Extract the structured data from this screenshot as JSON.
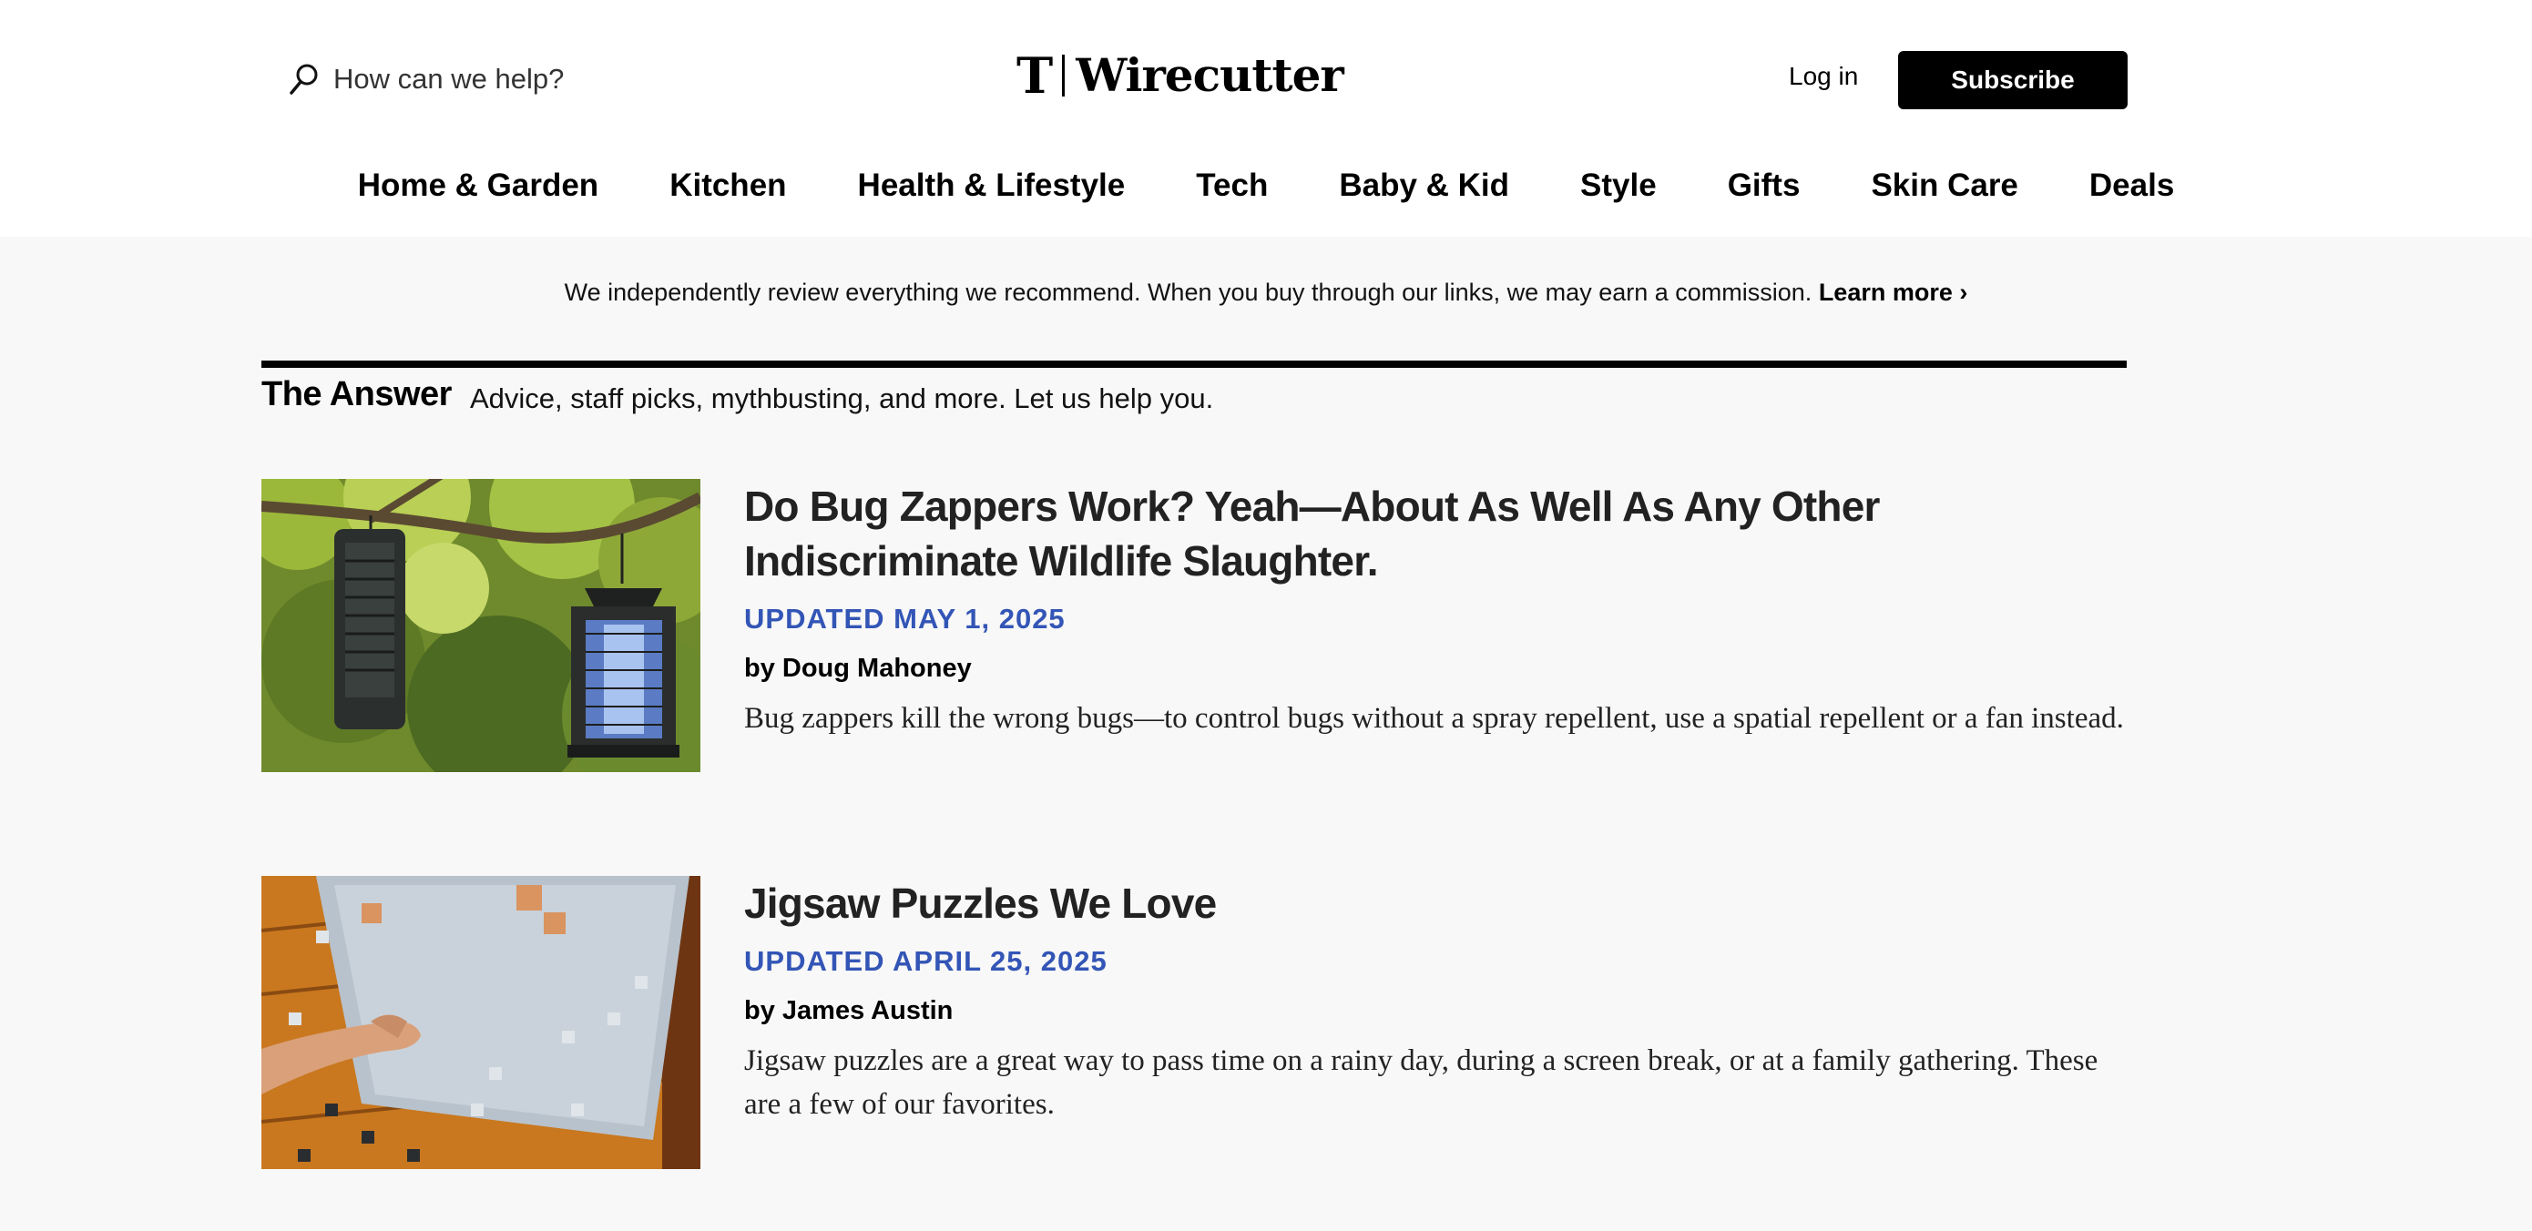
{
  "search": {
    "placeholder": "How can we help?"
  },
  "brand": {
    "mark": "T",
    "name": "Wirecutter"
  },
  "header": {
    "login_label": "Log in",
    "subscribe_label": "Subscribe"
  },
  "nav": {
    "items": [
      {
        "label": "Home & Garden"
      },
      {
        "label": "Kitchen"
      },
      {
        "label": "Health & Lifestyle"
      },
      {
        "label": "Tech"
      },
      {
        "label": "Baby & Kid"
      },
      {
        "label": "Style"
      },
      {
        "label": "Gifts"
      },
      {
        "label": "Skin Care"
      },
      {
        "label": "Deals"
      }
    ]
  },
  "disclosure": {
    "text": "We independently review everything we recommend. When you buy through our links, we may earn a commission.",
    "link_label": "Learn more ›"
  },
  "section": {
    "title": "The Answer",
    "description": "Advice, staff picks, mythbusting, and more. Let us help you."
  },
  "articles": [
    {
      "title": "Do Bug Zappers Work? Yeah—About As Well As Any Other Indiscriminate Wildlife Slaughter.",
      "date": "UPDATED MAY 1, 2025",
      "author": "by Doug Mahoney",
      "excerpt": "Bug zappers kill the wrong bugs—to control bugs without a spray repellent, use a spatial repellent or a fan instead.",
      "image": "bug-zappers-photo"
    },
    {
      "title": "Jigsaw Puzzles We Love",
      "date": "UPDATED APRIL 25, 2025",
      "author": "by James Austin",
      "excerpt": "Jigsaw puzzles are a great way to pass time on a rainy day, during a screen break, or at a family gathering. These are a few of our favorites.",
      "image": "jigsaw-puzzle-photo"
    }
  ],
  "colors": {
    "accent_date": "#3355b6",
    "page_bg": "#f8f8f8",
    "header_bg": "#ffffff",
    "button_bg": "#000000"
  }
}
